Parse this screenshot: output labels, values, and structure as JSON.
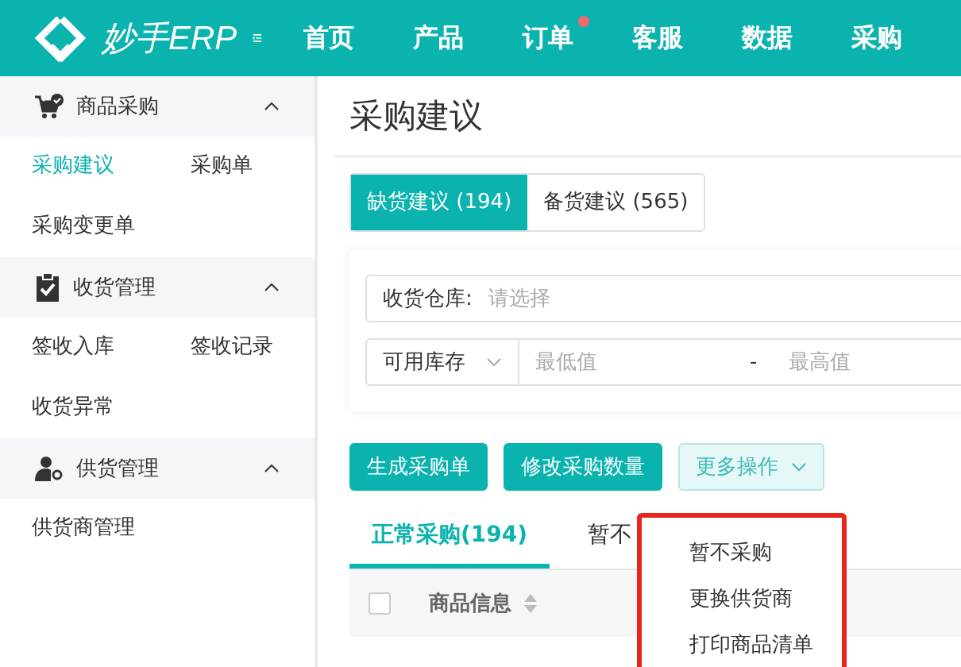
{
  "header": {
    "logo": "妙手ERP",
    "nav": [
      {
        "label": "首页",
        "dot": false
      },
      {
        "label": "产品",
        "dot": false
      },
      {
        "label": "订单",
        "dot": true
      },
      {
        "label": "客服",
        "dot": false
      },
      {
        "label": "数据",
        "dot": false
      },
      {
        "label": "采购",
        "dot": false
      }
    ]
  },
  "sidebar": {
    "sections": [
      {
        "title": "商品采购",
        "kind": "cart",
        "expanded": true,
        "items": [
          {
            "label": "采购建议",
            "selected": true
          },
          {
            "label": "采购单",
            "selected": false
          },
          {
            "label": "采购变更单",
            "selected": false
          }
        ]
      },
      {
        "title": "收货管理",
        "kind": "clipboard",
        "expanded": true,
        "items": [
          {
            "label": "签收入库",
            "selected": false
          },
          {
            "label": "签收记录",
            "selected": false
          },
          {
            "label": "收货异常",
            "selected": false
          }
        ]
      },
      {
        "title": "供货管理",
        "kind": "person",
        "expanded": true,
        "items": [
          {
            "label": "供货商管理",
            "selected": false
          }
        ]
      }
    ]
  },
  "page_title": "采购建议",
  "tabs": [
    {
      "label": "缺货建议 (194)",
      "selected": true
    },
    {
      "label": "备货建议 (565)",
      "selected": false
    }
  ],
  "filters": {
    "warehouse": {
      "label": "收货仓库:",
      "placeholder": "请选择"
    },
    "stock": {
      "select": "可用库存",
      "min_placeholder": "最低值",
      "separator": "-",
      "max_placeholder": "最高值"
    }
  },
  "actions": [
    {
      "label": "生成采购单",
      "kind": "primary"
    },
    {
      "label": "修改采购数量",
      "kind": "primary"
    },
    {
      "label": "更多操作",
      "kind": "dropdown"
    }
  ],
  "subtabs": [
    {
      "label": "正常采购(194)",
      "selected": true
    },
    {
      "label": "暂不",
      "selected": false
    }
  ],
  "table": {
    "select_all_checked": false,
    "columns": [
      "商品信息"
    ]
  },
  "dropdown": {
    "items": [
      "暂不采购",
      "更换供货商",
      "打印商品清单"
    ]
  }
}
